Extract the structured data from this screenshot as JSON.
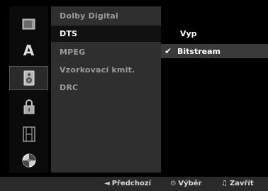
{
  "sidebar": {
    "items": [
      {
        "icon": "disc-icon",
        "selected": false
      },
      {
        "icon": "language-icon",
        "label": "A",
        "selected": false
      },
      {
        "icon": "speaker-icon",
        "selected": true
      },
      {
        "icon": "lock-icon",
        "selected": false
      },
      {
        "icon": "film-icon",
        "selected": false
      },
      {
        "icon": "settings-disc-icon",
        "selected": false
      }
    ]
  },
  "menu": {
    "items": [
      {
        "label": "Dolby Digital",
        "selected": false
      },
      {
        "label": "DTS",
        "selected": true
      },
      {
        "label": "MPEG",
        "selected": false
      },
      {
        "label": "Vzorkovací kmit.",
        "selected": false
      },
      {
        "label": "DRC",
        "selected": false
      }
    ]
  },
  "options": {
    "items": [
      {
        "label": "Vyp",
        "checked": false
      },
      {
        "label": "Bitstream",
        "checked": true
      }
    ],
    "check_glyph": "✔"
  },
  "footer": {
    "prev_glyph": "◄",
    "prev_label": "Předchozí",
    "select_glyph": "⊙",
    "select_label": "Výběr",
    "close_glyph": "♫",
    "close_label": "Zavřít"
  }
}
